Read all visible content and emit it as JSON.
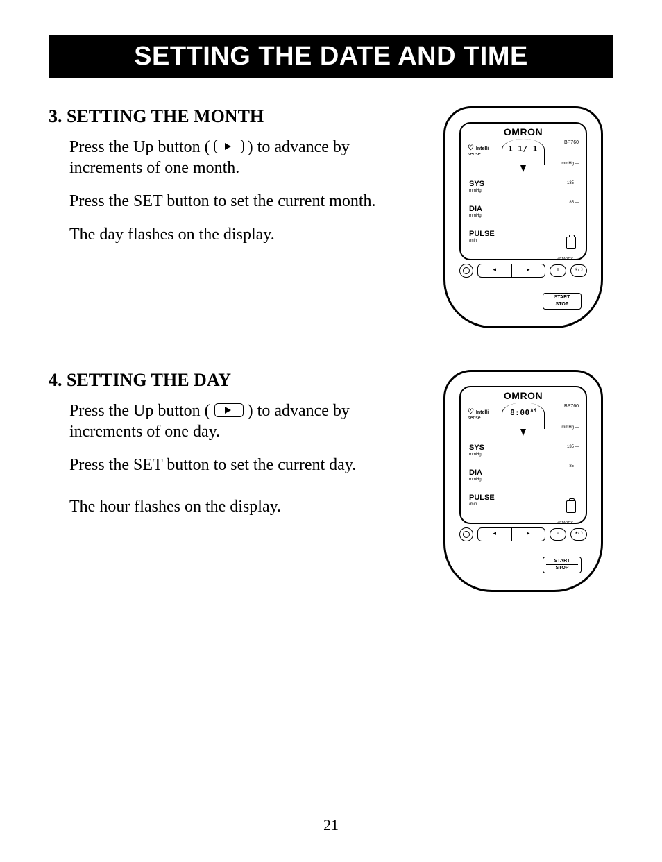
{
  "title": "SETTING THE DATE AND TIME",
  "pageNumber": "21",
  "sections": [
    {
      "heading": "3. SETTING THE MONTH",
      "paras": [
        {
          "before": "Press the Up button (",
          "after": ") to advance by increments of one month.",
          "hasIcon": true
        },
        {
          "text": "Press the SET button to set the current month."
        },
        {
          "text": "The day flashes on the display."
        }
      ],
      "device": {
        "timeDisplay": "1 1/  1",
        "ampm": ""
      }
    },
    {
      "heading": "4. SETTING THE DAY",
      "paras": [
        {
          "before": "Press the Up button (",
          "after": ") to advance by increments of one day.",
          "hasIcon": true
        },
        {
          "text": "Press the SET button to set the current day."
        },
        {
          "text": "The hour flashes on the display."
        }
      ],
      "device": {
        "timeDisplay": "8:00",
        "ampm": "AM"
      }
    }
  ],
  "device_common": {
    "brand": "OMRON",
    "model": "BP760",
    "intelli_line1": "Intelli",
    "intelli_line2": "sense",
    "sys": "SYS",
    "sys_unit": "mmHg",
    "dia": "DIA",
    "dia_unit": "mmHg",
    "pulse": "PULSE",
    "pulse_unit": "/min",
    "scale_mmhg": "mmHg",
    "scale_135": "135",
    "scale_85": "85",
    "memory": "MEMORY",
    "mem_icon": "≡",
    "user_icon": "☀/☽",
    "start": "START",
    "stop": "STOP",
    "arrow_left": "◂",
    "arrow_right": "▸"
  }
}
